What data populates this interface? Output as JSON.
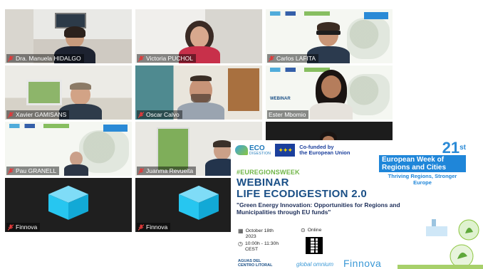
{
  "participants": [
    {
      "name": "Dra. Manuela HIDALGO"
    },
    {
      "name": "Victoria PUCHOL"
    },
    {
      "name": "Carlos LAFITA"
    },
    {
      "name": "Xavier GAMISANS"
    },
    {
      "name": "Oscar Calvo"
    },
    {
      "name": "Ester Mbomio"
    },
    {
      "name": "Pau GRANELL"
    },
    {
      "name": "Juanma Revuelta"
    },
    {
      "name": "Finnova"
    },
    {
      "name": "Finnova"
    }
  ],
  "tile_text": {
    "webinar": "WEBINAR"
  },
  "poster": {
    "eco_logo_text": "ECO",
    "eco_logo_sub": "DIGESTION",
    "eu_text_1": "Co-funded by",
    "eu_text_2": "the European Union",
    "ewrc_number": "21",
    "ewrc_suffix": "st",
    "ewrc_line1": "European Week of",
    "ewrc_line2": "Regions and Cities",
    "ewrc_tagline": "Thriving Regions, Stronger Europe",
    "hashtag": "#EUREGIONSWEEK",
    "title": "WEBINAR",
    "subtitle": "LIFE ECODIGESTION 2.0",
    "quote": "\"Green Energy Innovation: Opportunities for Regions and Municipalities through EU funds\"",
    "date_line1": "October 18th",
    "date_line2": "2023",
    "time_line1": "10:00h - 11:30h",
    "time_line2": "CEST",
    "location": "Online",
    "partner_1_line1": "AGUAS DEL",
    "partner_1_line2": "CENTRO LITORAL",
    "partner_2": "global omnium",
    "partner_3": "Finnova"
  },
  "colors": {
    "accent_yellow": "#d8e04a",
    "eu_blue": "#1b3f9c",
    "title_blue": "#1a4f86",
    "hashtag_green": "#6fb547",
    "ewrc_blue": "#1f86d9",
    "cube_cyan": "#27c6f0"
  }
}
